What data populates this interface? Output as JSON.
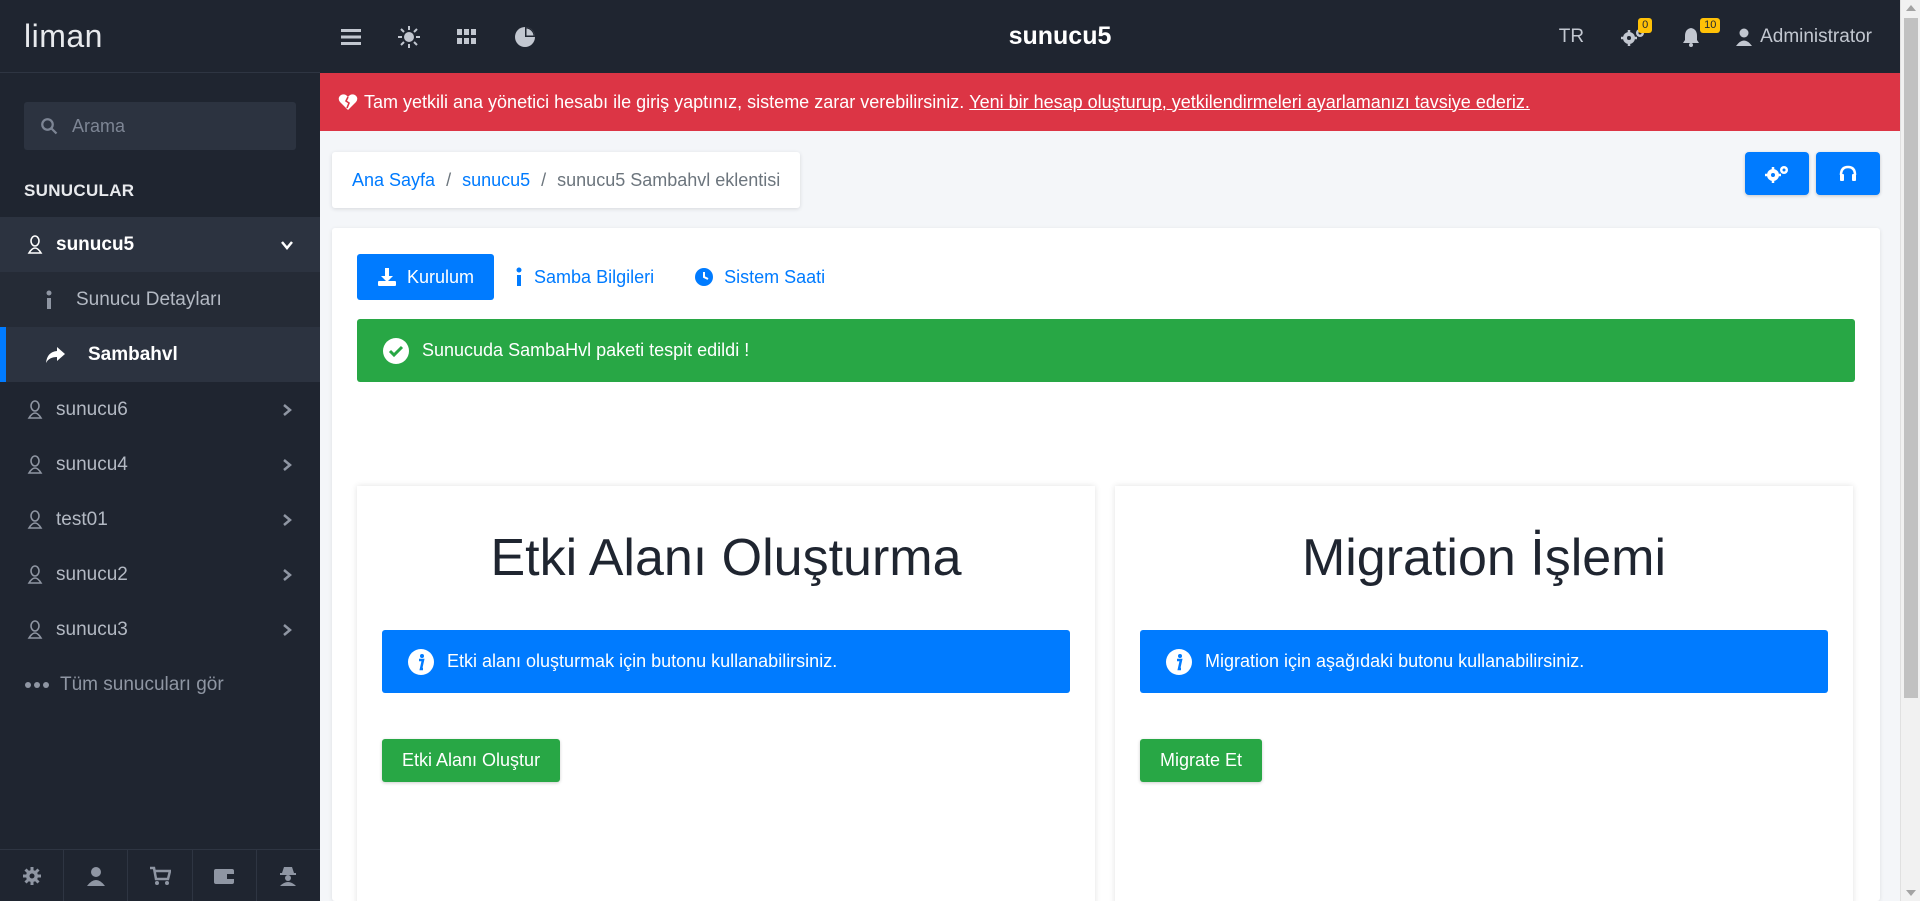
{
  "brand": {
    "name": "liman"
  },
  "search": {
    "placeholder": "Arama"
  },
  "sidebar": {
    "section_title": "SUNUCULAR",
    "servers": [
      {
        "label": "sunucu5",
        "open": true
      },
      {
        "label": "sunucu6"
      },
      {
        "label": "sunucu4"
      },
      {
        "label": "test01"
      },
      {
        "label": "sunucu2"
      },
      {
        "label": "sunucu3"
      }
    ],
    "sub_items": [
      {
        "label": "Sunucu Detayları",
        "icon": "info-icon"
      },
      {
        "label": "Sambahvl",
        "icon": "share-arrow-icon",
        "active": true
      }
    ],
    "see_all": "Tüm sunucuları gör",
    "footer_icons": [
      "gear-icon",
      "user-icon",
      "cart-icon",
      "wallet-icon",
      "user-secret-icon"
    ]
  },
  "topbar": {
    "title": "sunucu5",
    "lang": "TR",
    "settings_badge": "0",
    "notif_badge": "10",
    "user": "Administrator"
  },
  "alert": {
    "text": "Tam yetkili ana yönetici hesabı ile giriş yaptınız, sisteme zarar verebilirsiniz.",
    "link": "Yeni bir hesap oluşturup, yetkilendirmeleri ayarlamanızı tavsiye ederiz."
  },
  "breadcrumb": {
    "home": "Ana Sayfa",
    "server": "sunucu5",
    "current": "sunucu5 Sambahvl eklentisi"
  },
  "tabs": [
    "Kurulum",
    "Samba Bilgileri",
    "Sistem Saati"
  ],
  "success": "Sunucuda SambaHvl paketi tespit edildi !",
  "panels": {
    "left": {
      "title": "Etki Alanı Oluşturma",
      "info": "Etki alanı oluşturmak için butonu kullanabilirsiniz.",
      "button": "Etki Alanı Oluştur"
    },
    "right": {
      "title": "Migration İşlemi",
      "info": "Migration için aşağıdaki butonu kullanabilirsiniz.",
      "button": "Migrate Et"
    }
  },
  "colors": {
    "primary": "#007bff",
    "success": "#28a745",
    "danger": "#dc3545",
    "sidebar": "#1f2530"
  }
}
